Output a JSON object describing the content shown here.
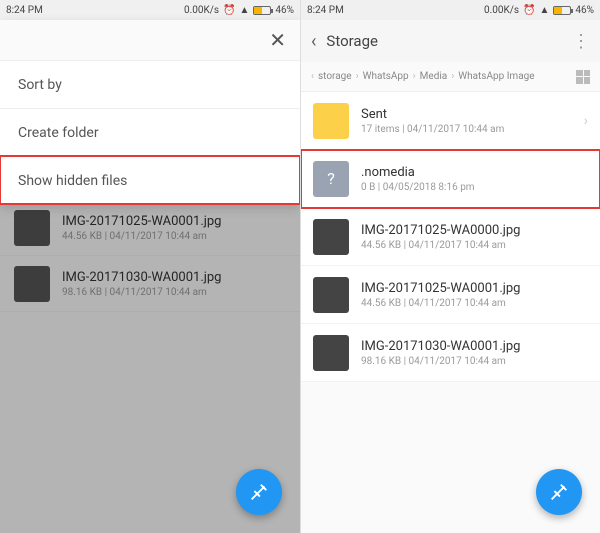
{
  "status": {
    "time": "8:24 PM",
    "speed": "0.00K/s",
    "battery": "46%"
  },
  "left": {
    "menu": {
      "close": "✕",
      "items": [
        "Sort by",
        "Create folder",
        "Show hidden files"
      ]
    },
    "behind": [
      {
        "name": "IMG-20171025-WA0001.jpg",
        "sub": "44.56 KB  |  04/11/2017 10:44 am"
      },
      {
        "name": "IMG-20171030-WA0001.jpg",
        "sub": "98.16 KB  |  04/11/2017 10:44 am"
      }
    ]
  },
  "right": {
    "title": "Storage",
    "crumbs": [
      "storage",
      "WhatsApp",
      "Media",
      "WhatsApp Image"
    ],
    "rows": [
      {
        "type": "folder",
        "name": "Sent",
        "sub": "17 items  |  04/11/2017 10:44 am",
        "chev": true
      },
      {
        "type": "unknown",
        "name": ".nomedia",
        "sub": "0 B  |  04/05/2018 8:16 pm",
        "hl": true
      },
      {
        "type": "img",
        "name": "IMG-20171025-WA0000.jpg",
        "sub": "44.56 KB  |  04/11/2017 10:44 am"
      },
      {
        "type": "img",
        "name": "IMG-20171025-WA0001.jpg",
        "sub": "44.56 KB  |  04/11/2017 10:44 am"
      },
      {
        "type": "img",
        "name": "IMG-20171030-WA0001.jpg",
        "sub": "98.16 KB  |  04/11/2017 10:44 am"
      }
    ]
  }
}
